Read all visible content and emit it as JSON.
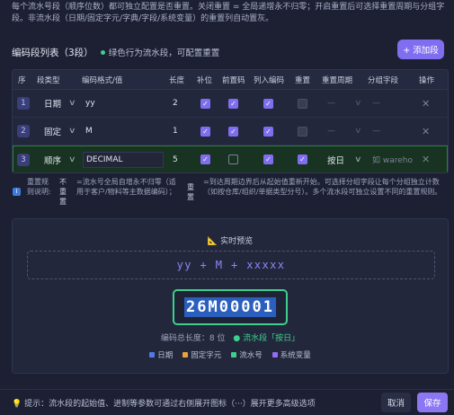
{
  "intro": "每个流水号段（顺序位数）都可独立配置是否重置。关闭重置 = 全局递增永不归零；开启重置后可选择重置周期与分组字段。非流水段（日期/固定字元/字典/字段/系统变量）的重置列自动置灰。",
  "section": {
    "title": "编码段列表（3段）",
    "hint": "绿色行为流水段，可配置重置",
    "add_button": "+ 添加段"
  },
  "table": {
    "headers": {
      "seq": "序",
      "type": "段类型",
      "format": "编码格式/值",
      "length": "长度",
      "pad": "补位",
      "prefix_zero": "前置码",
      "include": "列入编码",
      "reset": "重置",
      "period": "重置周期",
      "group": "分组字段",
      "ops": "操作"
    },
    "rows": [
      {
        "seq": "1",
        "type": "日期",
        "format": "yy",
        "length": "2",
        "pad": true,
        "prefix_zero": true,
        "include": true,
        "reset": "disabled",
        "period": "—",
        "group": "—"
      },
      {
        "seq": "2",
        "type": "固定",
        "format": "M",
        "length": "1",
        "pad": true,
        "prefix_zero": true,
        "include": true,
        "reset": "disabled",
        "period": "—",
        "group": "—"
      },
      {
        "seq": "3",
        "type": "顺序",
        "format": "DECIMAL",
        "length": "5",
        "pad": true,
        "prefix_zero": false,
        "include": true,
        "reset": true,
        "period": "按日",
        "group": "如 wareho"
      }
    ]
  },
  "legend": {
    "label": "重置规则说明:",
    "off_title": "不重置",
    "off_desc": "=流水号全局自增永不归零（适用于客户/物料等主数据编码）；",
    "on_title": "重置",
    "on_desc": "=到达周期边界后从起始值重新开始。可选择分组字段让每个分组独立计数（如按仓库/组织/单据类型分号）。多个流水段可独立设置不同的重置规则。"
  },
  "preview": {
    "title": "实时预览",
    "format_pattern": "yy + M + xxxxx",
    "code": "26M00001",
    "length_label": "编码总长度：8 位",
    "serial_label": "流水段「按日」",
    "legend": [
      {
        "label": "日期",
        "color": "#4f7be8"
      },
      {
        "label": "固定字元",
        "color": "#e8a23c"
      },
      {
        "label": "流水号",
        "color": "#3ecf8e"
      },
      {
        "label": "系统变量",
        "color": "#8f6ef0"
      }
    ]
  },
  "footer": {
    "tip": "提示：流水段的起始值、进制等参数可通过右侧展开图标（···）展开更多高级选项",
    "cancel": "取消",
    "save": "保存"
  }
}
